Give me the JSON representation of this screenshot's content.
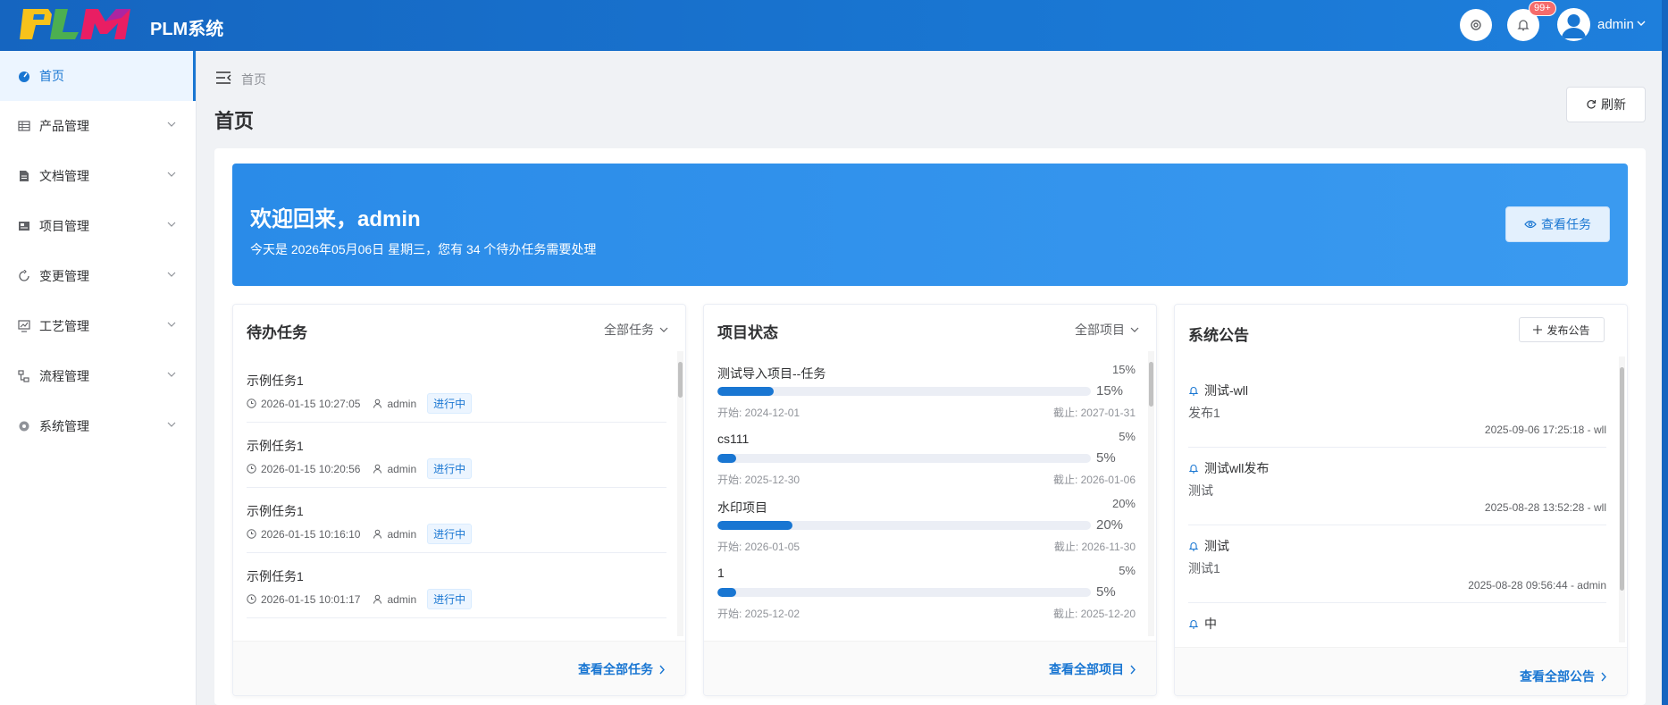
{
  "app": {
    "logo_text": "PLM",
    "title": "PLM系统"
  },
  "header": {
    "badge": "99+",
    "user": "admin"
  },
  "sidebar": {
    "items": [
      {
        "label": "首页",
        "icon": "dashboard-icon"
      },
      {
        "label": "产品管理",
        "icon": "table-icon"
      },
      {
        "label": "文档管理",
        "icon": "document-icon"
      },
      {
        "label": "项目管理",
        "icon": "project-icon"
      },
      {
        "label": "变更管理",
        "icon": "change-icon"
      },
      {
        "label": "工艺管理",
        "icon": "process-icon"
      },
      {
        "label": "流程管理",
        "icon": "flow-icon"
      },
      {
        "label": "系统管理",
        "icon": "gear-icon"
      }
    ]
  },
  "breadcrumb": "首页",
  "page_title": "首页",
  "refresh_label": "刷新",
  "welcome": {
    "title": "欢迎回来，admin",
    "subtitle": "今天是 2026年05月06日 星期三，您有 34 个待办任务需要处理",
    "button": "查看任务"
  },
  "tasks": {
    "title": "待办任务",
    "filter": "全部任务",
    "items": [
      {
        "name": "示例任务1",
        "time": "2026-01-15 10:27:05",
        "user": "admin",
        "status": "进行中"
      },
      {
        "name": "示例任务1",
        "time": "2026-01-15 10:20:56",
        "user": "admin",
        "status": "进行中"
      },
      {
        "name": "示例任务1",
        "time": "2026-01-15 10:16:10",
        "user": "admin",
        "status": "进行中"
      },
      {
        "name": "示例任务1",
        "time": "2026-01-15 10:01:17",
        "user": "admin",
        "status": "进行中"
      }
    ],
    "footer": "查看全部任务"
  },
  "projects": {
    "title": "项目状态",
    "filter": "全部项目",
    "items": [
      {
        "name": "测试导入项目--任务",
        "pct": "15%",
        "progress": 0.15,
        "start": "开始: 2024-12-01",
        "end": "截止: 2027-01-31"
      },
      {
        "name": "cs111",
        "pct": "5%",
        "progress": 0.05,
        "start": "开始: 2025-12-30",
        "end": "截止: 2026-01-06"
      },
      {
        "name": "水印项目",
        "pct": "20%",
        "progress": 0.2,
        "start": "开始: 2026-01-05",
        "end": "截止: 2026-11-30"
      },
      {
        "name": "1",
        "pct": "5%",
        "progress": 0.05,
        "start": "开始: 2025-12-02",
        "end": "截止: 2025-12-20"
      }
    ],
    "footer": "查看全部项目"
  },
  "announcements": {
    "title": "系统公告",
    "publish": "发布公告",
    "items": [
      {
        "title": "测试-wll",
        "content": "发布1",
        "meta": "2025-09-06 17:25:18 - wll"
      },
      {
        "title": "测试wll发布",
        "content": "测试",
        "meta": "2025-08-28 13:52:28 - wll"
      },
      {
        "title": "测试",
        "content": "测试1",
        "meta": "2025-08-28 09:56:44 - admin"
      },
      {
        "title": "中",
        "content": "",
        "meta": ""
      }
    ],
    "footer": "查看全部公告"
  },
  "colors": {
    "primary": "#1976d2",
    "header": "#1565c0",
    "badge": "#f56c6c"
  }
}
